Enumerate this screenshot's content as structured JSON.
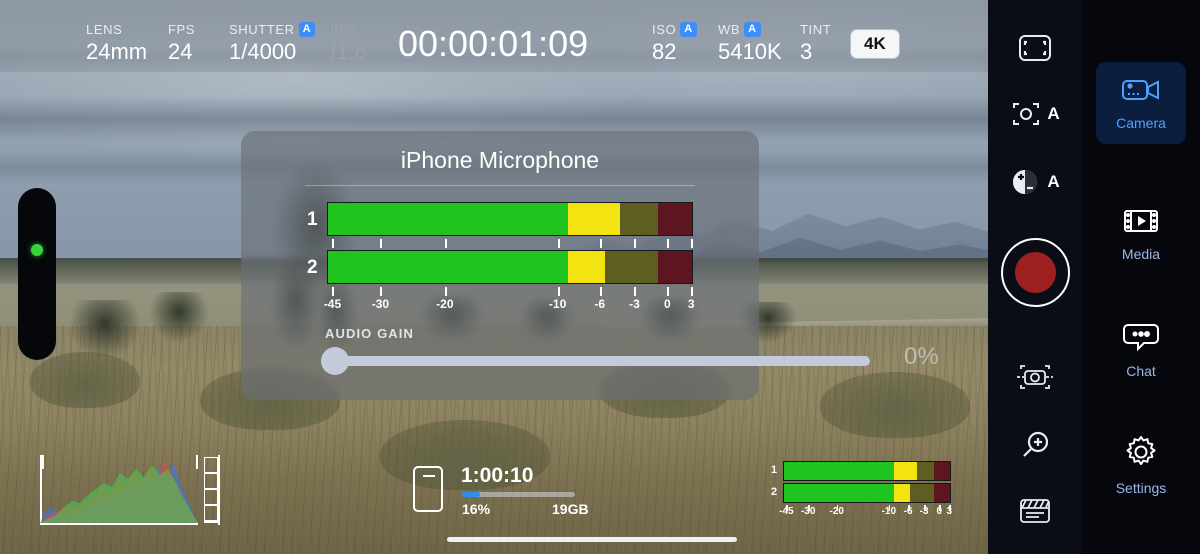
{
  "topbar": {
    "items": [
      {
        "label": "LENS",
        "value": "24mm",
        "auto": false,
        "dim": false
      },
      {
        "label": "FPS",
        "value": "24",
        "auto": false,
        "dim": false
      },
      {
        "label": "SHUTTER",
        "value": "1/4000",
        "auto": true,
        "dim": false
      },
      {
        "label": "IRIS",
        "value": "f1.8",
        "auto": false,
        "dim": true
      },
      {
        "label": "ISO",
        "value": "82",
        "auto": true,
        "dim": false
      },
      {
        "label": "WB",
        "value": "5410K",
        "auto": true,
        "dim": false
      },
      {
        "label": "TINT",
        "value": "3",
        "auto": false,
        "dim": false
      }
    ],
    "timecode": "00:00:01:09",
    "resolution_button": "4K",
    "auto_badge": "A"
  },
  "audio_dialog": {
    "title": "iPhone Microphone",
    "channels": [
      {
        "number": "1",
        "segments": [
          {
            "color": "green",
            "pct": 66.0
          },
          {
            "color": "yellow",
            "pct": 14.2
          },
          {
            "color": "olive",
            "pct": 10.4
          },
          {
            "color": "red",
            "pct": 9.4
          }
        ]
      },
      {
        "number": "2",
        "segments": [
          {
            "color": "green",
            "pct": 66.0
          },
          {
            "color": "yellow",
            "pct": 10.0
          },
          {
            "color": "olive",
            "pct": 14.6
          },
          {
            "color": "red",
            "pct": 9.4
          }
        ]
      }
    ],
    "scale": [
      {
        "label": "-45",
        "pct": 1.5
      },
      {
        "label": "-30",
        "pct": 14.6
      },
      {
        "label": "-20",
        "pct": 32.2
      },
      {
        "label": "-10",
        "pct": 63.0
      },
      {
        "label": "-6",
        "pct": 74.5
      },
      {
        "label": "-3",
        "pct": 84.0
      },
      {
        "label": "0",
        "pct": 93.0
      },
      {
        "label": "3",
        "pct": 99.5
      }
    ],
    "gain_label": "AUDIO GAIN",
    "gain_value": "0%",
    "gain_percent": 0
  },
  "histogram": {
    "name": "rgb-histogram"
  },
  "storage": {
    "time_remaining": "1:00:10",
    "percent_label": "16%",
    "percent": 16,
    "size_label": "19GB"
  },
  "mini_meter": {
    "channels": [
      {
        "number": "1",
        "segments": [
          {
            "color": "green",
            "pct": 66.0
          },
          {
            "color": "yellow",
            "pct": 14.2
          },
          {
            "color": "olive",
            "pct": 10.4
          },
          {
            "color": "red",
            "pct": 9.4
          }
        ]
      },
      {
        "number": "2",
        "segments": [
          {
            "color": "green",
            "pct": 66.0
          },
          {
            "color": "yellow",
            "pct": 10.0
          },
          {
            "color": "olive",
            "pct": 14.6
          },
          {
            "color": "red",
            "pct": 9.4
          }
        ]
      }
    ],
    "scale": [
      {
        "label": "-45",
        "pct": 2.0
      },
      {
        "label": "-30",
        "pct": 15.0
      },
      {
        "label": "-20",
        "pct": 32.0
      },
      {
        "label": "-10",
        "pct": 63.0
      },
      {
        "label": "-6",
        "pct": 74.5
      },
      {
        "label": "-3",
        "pct": 84.0
      },
      {
        "label": "0",
        "pct": 93.0
      },
      {
        "label": "3",
        "pct": 99.0
      }
    ]
  },
  "tools": [
    {
      "name": "framing-guide-icon",
      "auto": ""
    },
    {
      "name": "focus-reticle-icon",
      "auto": "A"
    },
    {
      "name": "exposure-icon",
      "auto": "A"
    },
    {
      "name": "record-button",
      "auto": ""
    },
    {
      "name": "stabilizer-icon",
      "auto": ""
    },
    {
      "name": "zoom-magnifier-icon",
      "auto": ""
    },
    {
      "name": "slate-icon",
      "auto": ""
    }
  ],
  "sidebar": {
    "items": [
      {
        "label": "Camera",
        "icon": "camcorder-icon",
        "active": true
      },
      {
        "label": "Media",
        "icon": "filmstrip-icon",
        "active": false
      },
      {
        "label": "Chat",
        "icon": "chat-bubble-icon",
        "active": false
      },
      {
        "label": "Settings",
        "icon": "gear-icon",
        "active": false
      }
    ],
    "accent_color": "#4da0ff",
    "active_bg": "#0b1e3d"
  }
}
